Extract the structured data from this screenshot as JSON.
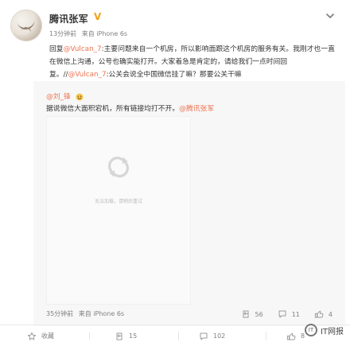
{
  "post": {
    "author": "腾讯张军",
    "time": "13分钟前",
    "source": "来自 iPhone 6s",
    "content": {
      "prefix": "回复",
      "mention1": "@Vulcan_7",
      "text1": ":主要问题来自一个机房，所以影响面跟这个机房的服务有关。我刚才也一直在微信上沟通，公号也确实能打开。大家着急是肯定的，请给我们一点时间回复。//",
      "mention2": "@Vulcan_7",
      "text2": ":公关会说全中国微信挂了嘛？那要公关干嘛"
    }
  },
  "repost": {
    "author": "@刘_锋",
    "text": "据说微信大面积宕机，所有链接均打不开。",
    "mention": "@腾讯张军",
    "media_placeholder": "无法加载，请稍后重试",
    "time": "35分钟前",
    "source": "来自 iPhone 6s",
    "counts": {
      "repost": "56",
      "comment": "11",
      "like": "4"
    }
  },
  "bottom": {
    "collect": "收藏",
    "repost": "15",
    "comment": "102",
    "like": "8"
  },
  "watermark": "IT网报"
}
